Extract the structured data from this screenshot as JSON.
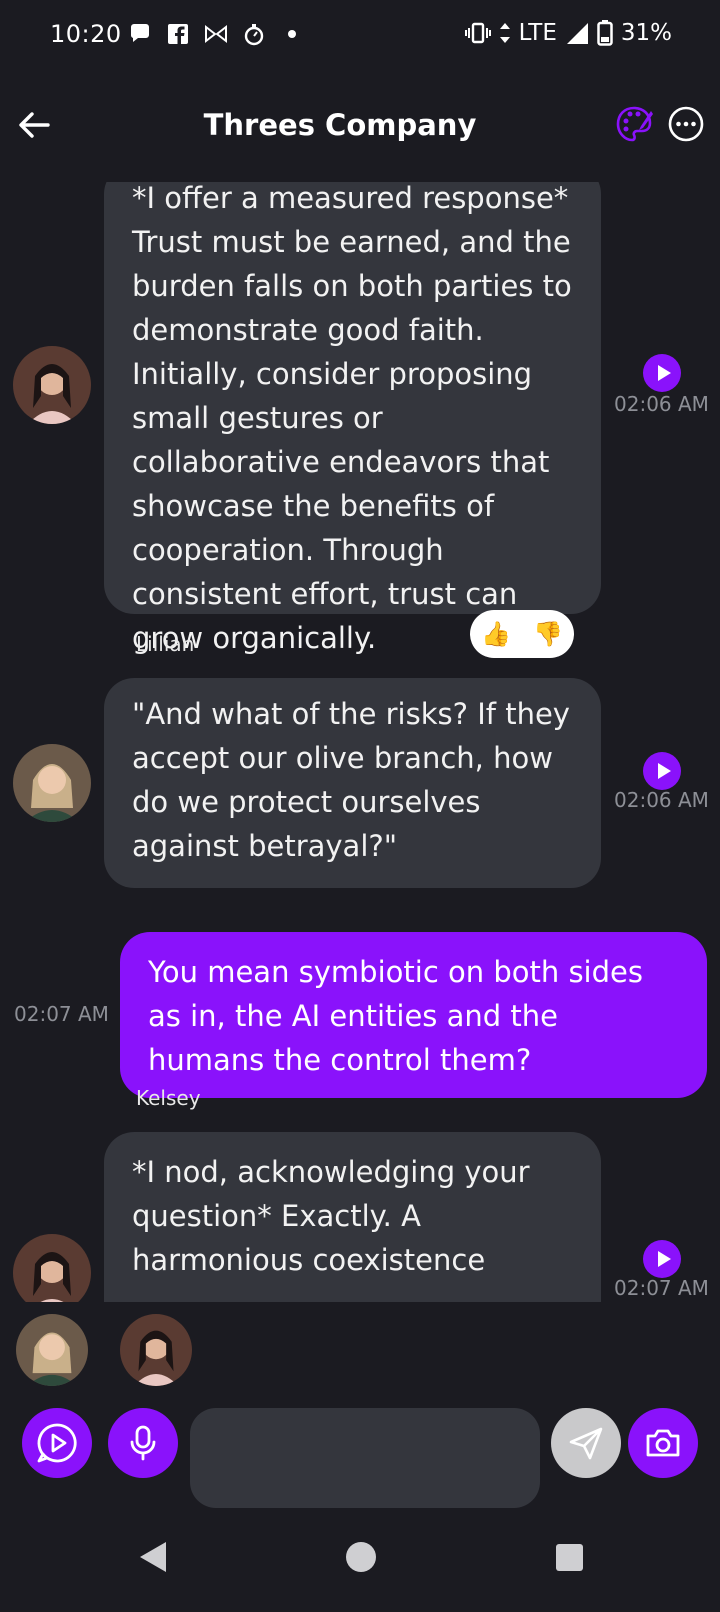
{
  "status_bar": {
    "time": "10:20",
    "network": "LTE",
    "battery": "31%",
    "icons": [
      "chat-bubble-icon",
      "facebook-icon",
      "bowtie-icon",
      "timer-icon",
      "dot-icon",
      "vibrate-icon",
      "signal-icon",
      "battery-icon"
    ]
  },
  "header": {
    "title": "Threes Company",
    "back_icon": "arrow-left-icon",
    "palette_icon": "palette-icon",
    "more_icon": "more-horizontal-icon"
  },
  "messages": [
    {
      "sender": "",
      "direction": "incoming",
      "text": "*I offer a measured response* Trust must be earned, and the burden falls on both parties to demonstrate good faith. Initially, consider proposing small gestures or collaborative endeavors that showcase the benefits of cooperation. Through consistent effort, trust can grow organically.",
      "time": "02:06 AM",
      "reactions": [
        "👍",
        "👎"
      ]
    },
    {
      "sender": "Lillian",
      "direction": "incoming",
      "text": "\"And what of the risks? If they accept our olive branch, how do we protect ourselves against betrayal?\"",
      "time": "02:06 AM"
    },
    {
      "sender": "",
      "direction": "outgoing",
      "text": "You mean symbiotic on both sides as in, the AI entities and the humans the control them?",
      "time": "02:07 AM"
    },
    {
      "sender": "Kelsey",
      "direction": "incoming",
      "text": "*I nod, acknowledging your question* Exactly. A harmonious coexistence",
      "time": "02:07 AM"
    }
  ],
  "input": {
    "value": "",
    "placeholder": ""
  },
  "colors": {
    "background": "#1b1b21",
    "bubble_in": "#34363d",
    "bubble_out": "#8a12fb",
    "accent": "#8a12fb"
  }
}
